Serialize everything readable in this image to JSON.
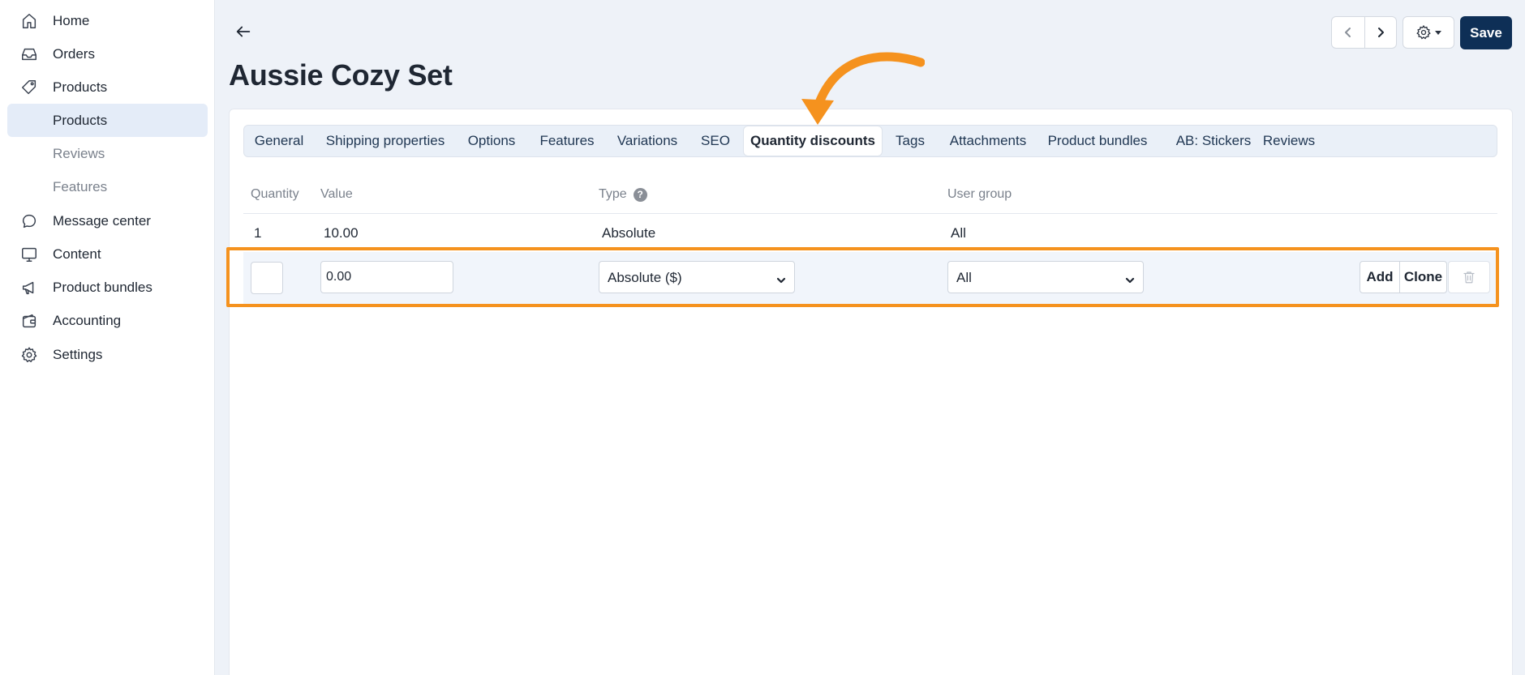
{
  "sidebar": {
    "items": [
      {
        "label": "Home",
        "icon": "home-icon"
      },
      {
        "label": "Orders",
        "icon": "inbox-icon"
      },
      {
        "label": "Products",
        "icon": "tag-icon"
      },
      {
        "label": "Products"
      },
      {
        "label": "Reviews"
      },
      {
        "label": "Features"
      },
      {
        "label": "Message center",
        "icon": "chat-icon"
      },
      {
        "label": "Content",
        "icon": "monitor-icon"
      },
      {
        "label": "Product bundles",
        "icon": "megaphone-icon"
      },
      {
        "label": "Accounting",
        "icon": "wallet-icon"
      },
      {
        "label": "Settings",
        "icon": "gear-icon"
      }
    ]
  },
  "header": {
    "title": "Aussie Cozy Set",
    "save_label": "Save"
  },
  "tabs": [
    "General",
    "Shipping properties",
    "Options",
    "Features",
    "Variations",
    "SEO",
    "Quantity discounts",
    "Tags",
    "Attachments",
    "Product bundles",
    "AB: Stickers",
    "Reviews"
  ],
  "active_tab": "Quantity discounts",
  "table": {
    "headers": [
      "Quantity",
      "Value",
      "Type",
      "User group"
    ],
    "rows": [
      {
        "quantity": "1",
        "value": "10.00",
        "type": "Absolute",
        "user_group": "All"
      }
    ],
    "new_row": {
      "quantity": "",
      "value": "0.00",
      "type": "Absolute ($)",
      "user_group": "All",
      "add_label": "Add",
      "clone_label": "Clone"
    }
  },
  "colors": {
    "accent": "#0e2f56",
    "highlight": "#f5921e",
    "active_nav": "#e4ecf8"
  }
}
